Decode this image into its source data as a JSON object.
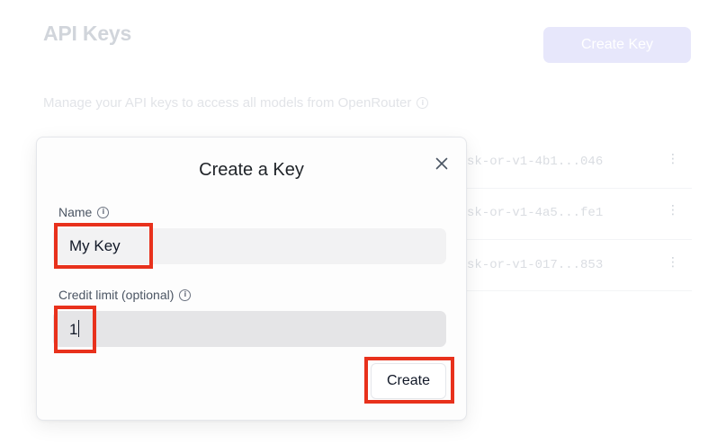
{
  "page": {
    "title": "API Keys",
    "create_key_label": "Create Key",
    "description": "Manage your API keys to access all models from OpenRouter",
    "keys": [
      {
        "masked": "sk-or-v1-4b1...046"
      },
      {
        "masked": "sk-or-v1-4a5...fe1"
      },
      {
        "masked": "sk-or-v1-017...853"
      }
    ]
  },
  "modal": {
    "title": "Create a Key",
    "name_label": "Name",
    "name_value": "My Key",
    "credit_label": "Credit limit (optional)",
    "credit_value": "1",
    "create_label": "Create"
  },
  "icons": {
    "close": "close-icon",
    "info": "info-icon",
    "kebab": "kebab-menu-icon"
  },
  "colors": {
    "highlight": "#e8311c",
    "accent_disabled": "#e7e7fb"
  }
}
